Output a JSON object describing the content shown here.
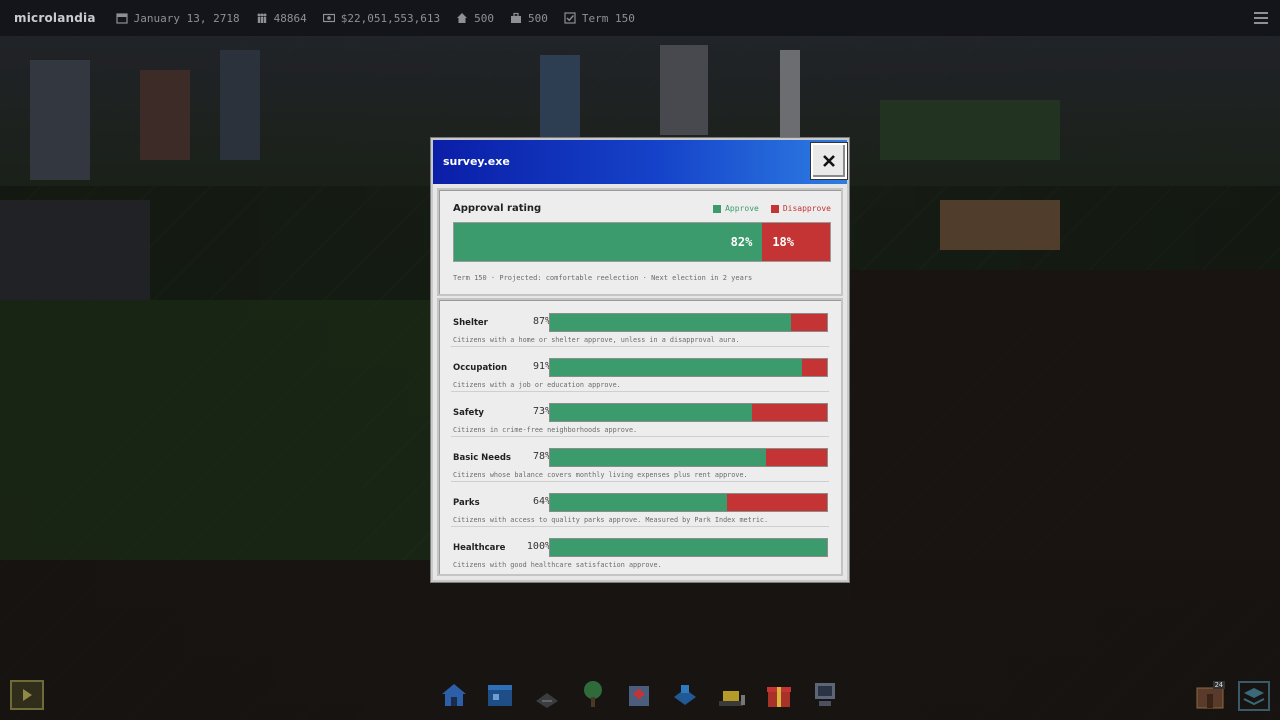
{
  "topbar": {
    "brand": "microlandia",
    "date": "January 13, 2718",
    "population": "48864",
    "funds": "$22,051,553,613",
    "housing": "500",
    "jobs": "500",
    "term": "Term 150"
  },
  "dialog": {
    "title": "survey.exe",
    "approval": {
      "heading": "Approval rating",
      "legend_approve": "Approve",
      "legend_disapprove": "Disapprove",
      "approve_pct": 82,
      "disapprove_pct": 18,
      "approve_label": "82%",
      "disapprove_label": "18%",
      "note": "Term 150 · Projected: comfortable reelection · Next election in 2 years"
    },
    "categories": [
      {
        "name": "Shelter",
        "pct": 87,
        "pct_label": "87%",
        "desc": "Citizens with a home or shelter approve, unless in a disapproval aura."
      },
      {
        "name": "Occupation",
        "pct": 91,
        "pct_label": "91%",
        "desc": "Citizens with a job or education approve."
      },
      {
        "name": "Safety",
        "pct": 73,
        "pct_label": "73%",
        "desc": "Citizens in crime-free neighborhoods approve."
      },
      {
        "name": "Basic Needs",
        "pct": 78,
        "pct_label": "78%",
        "desc": "Citizens whose balance covers monthly living expenses plus rent approve."
      },
      {
        "name": "Parks",
        "pct": 64,
        "pct_label": "64%",
        "desc": "Citizens with access to quality parks approve. Measured by Park Index metric."
      },
      {
        "name": "Healthcare",
        "pct": 100,
        "pct_label": "100%",
        "desc": "Citizens with good healthcare satisfaction approve."
      }
    ]
  },
  "toolbar": {
    "badge": "24"
  },
  "colors": {
    "approve": "#3b9b6c",
    "disapprove": "#c43434",
    "title_gradient_start": "#0b1ea8",
    "title_gradient_end": "#2e7de4"
  }
}
